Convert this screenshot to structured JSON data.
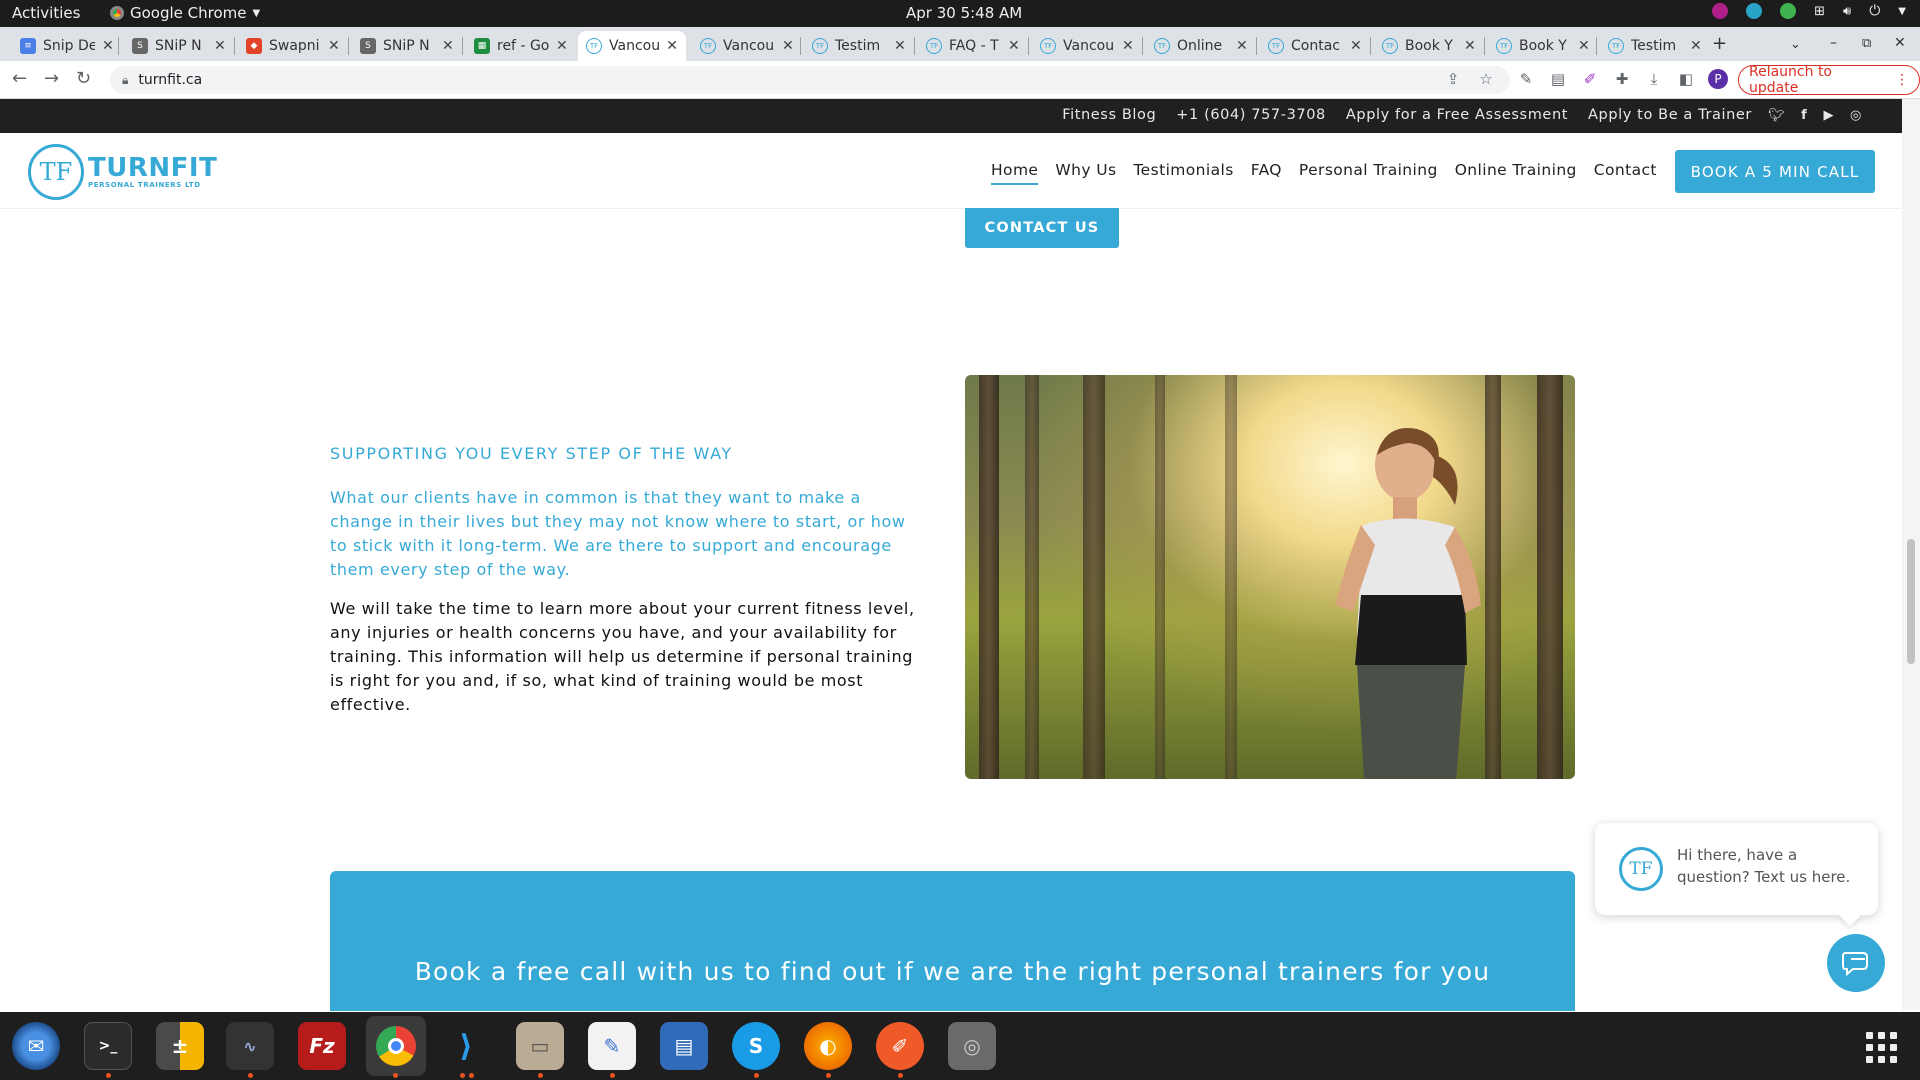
{
  "system": {
    "activities": "Activities",
    "app_name": "Google Chrome",
    "clock": "Apr 30  5:48 AM"
  },
  "tabs": [
    {
      "title": "Snip De",
      "icon": "docs-icon"
    },
    {
      "title": "SNiP N",
      "icon": "snip-icon"
    },
    {
      "title": "Swapni",
      "icon": "gitlab-icon"
    },
    {
      "title": "SNiP N",
      "icon": "snip-icon"
    },
    {
      "title": "ref - Go",
      "icon": "sheets-icon"
    },
    {
      "title": "Vancou",
      "icon": "turnfit-icon",
      "active": true
    },
    {
      "title": "Vancou",
      "icon": "turnfit-icon"
    },
    {
      "title": "Testim",
      "icon": "turnfit-icon"
    },
    {
      "title": "FAQ - T",
      "icon": "turnfit-icon"
    },
    {
      "title": "Vancou",
      "icon": "turnfit-icon"
    },
    {
      "title": "Online",
      "icon": "turnfit-icon"
    },
    {
      "title": "Contac",
      "icon": "turnfit-icon"
    },
    {
      "title": "Book Y",
      "icon": "turnfit-icon"
    },
    {
      "title": "Book Y",
      "icon": "turnfit-icon"
    },
    {
      "title": "Testim",
      "icon": "turnfit-icon"
    }
  ],
  "browser": {
    "url": "turnfit.ca",
    "relaunch_label": "Relaunch to update",
    "profile_initial": "P"
  },
  "site": {
    "utility_links": [
      "Fitness Blog",
      "+1 (604) 757-3708",
      "Apply for a Free Assessment",
      "Apply to Be a Trainer"
    ],
    "logo_mark": "TF",
    "logo_word": "TURNFIT",
    "logo_sub": "PERSONAL TRAINERS LTD",
    "nav": [
      "Home",
      "Why Us",
      "Testimonials",
      "FAQ",
      "Personal Training",
      "Online Training",
      "Contact"
    ],
    "book_call": "BOOK A 5 MIN CALL",
    "contact_us": "CONTACT US",
    "support_heading": "SUPPORTING YOU EVERY STEP OF THE WAY",
    "support_intro": "What our clients have in common is that they want to make a change in their lives but they may not know where to start, or how to stick with it long-term. We are there to support and encourage them every step of the way.",
    "support_body": "We will take the time to learn more about your current fitness level, any injuries or health concerns you have, and your availability for training. This information will help us determine if personal training is right for you and, if so, what kind of training would be most effective.",
    "cta_text": "Book a free call with us to find out if we are the right personal trainers for you",
    "chat_avatar": "TF",
    "chat_message": "Hi there, have a question? Text us here."
  },
  "colors": {
    "brand": "#36a9d6",
    "dark_bar": "#1f2020",
    "relaunch": "#d93025"
  }
}
